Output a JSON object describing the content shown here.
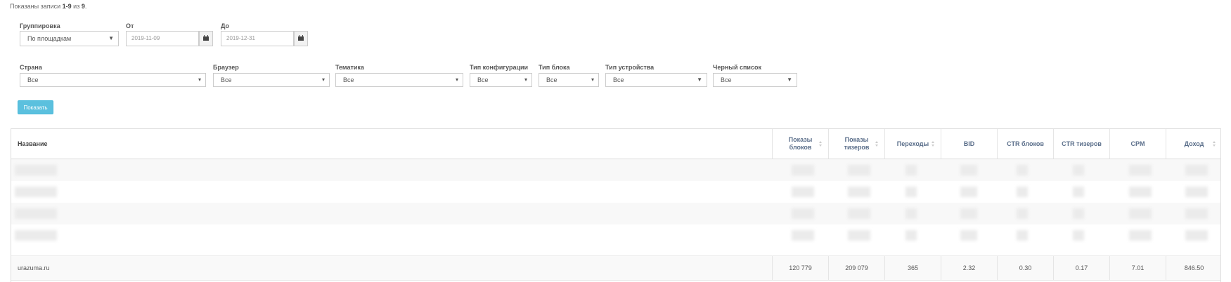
{
  "summary": {
    "prefix": "Показаны записи ",
    "range": "1-9",
    "mid": " из ",
    "total": "9",
    "suffix": "."
  },
  "filters": {
    "grouping": {
      "label": "Группировка",
      "value": "По площадкам"
    },
    "from": {
      "label": "От",
      "value": "2019-11-09"
    },
    "to": {
      "label": "До",
      "value": "2019-12-31"
    },
    "country": {
      "label": "Страна",
      "value": "Все"
    },
    "browser": {
      "label": "Браузер",
      "value": "Все"
    },
    "topic": {
      "label": "Тематика",
      "value": "Все"
    },
    "config_type": {
      "label": "Тип конфигурации",
      "value": "Все"
    },
    "block_type": {
      "label": "Тип блока",
      "value": "Все"
    },
    "device_type": {
      "label": "Тип устройства",
      "value": "Все"
    },
    "blacklist": {
      "label": "Черный список",
      "value": "Все"
    }
  },
  "show_button": "Показать",
  "table": {
    "columns": [
      {
        "label": "Название"
      },
      {
        "label": "Показы\nблоков"
      },
      {
        "label": "Показы\nтизеров"
      },
      {
        "label": "Переходы"
      },
      {
        "label": "BID"
      },
      {
        "label": "CTR блоков"
      },
      {
        "label": "CTR тизеров"
      },
      {
        "label": "CPM"
      },
      {
        "label": "Доход"
      }
    ],
    "row": [
      "urazuma.ru",
      "120 779",
      "209 079",
      "365",
      "2.32",
      "0.30",
      "0.17",
      "7.01",
      "846.50"
    ]
  },
  "colors": {
    "accent": "#5bc0de",
    "header_text": "#5a6e8a"
  }
}
